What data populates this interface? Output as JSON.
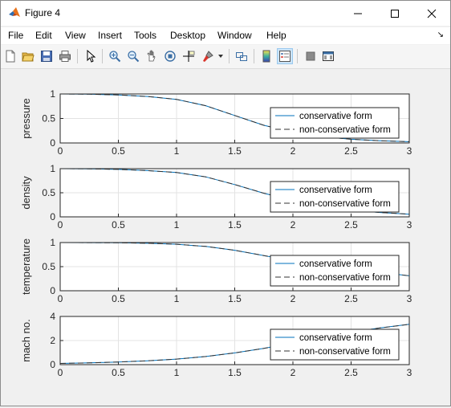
{
  "window": {
    "title": "Figure 4",
    "controls": [
      "minimize",
      "maximize",
      "close"
    ]
  },
  "menu": [
    "File",
    "Edit",
    "View",
    "Insert",
    "Tools",
    "Desktop",
    "Window",
    "Help"
  ],
  "toolbar": {
    "icons": [
      "new-figure-icon",
      "open-file-icon",
      "save-icon",
      "print-icon",
      "select-arrow-icon",
      "zoom-in-icon",
      "zoom-out-icon",
      "pan-icon",
      "rotate-3d-icon",
      "data-cursor-icon",
      "brush-icon",
      "brush-dropdown-icon",
      "link-plot-icon",
      "insert-colorbar-icon",
      "insert-legend-icon",
      "hide-plot-tools-icon",
      "show-plot-tools-icon"
    ]
  },
  "chart_data": [
    {
      "type": "line",
      "ylabel": "pressure",
      "xlim": [
        0,
        3
      ],
      "ylim": [
        0,
        1
      ],
      "xticks": [
        "0",
        "0.5",
        "1",
        "1.5",
        "2",
        "2.5",
        "3"
      ],
      "yticks": [
        "0",
        "0.5",
        "1"
      ],
      "grid": true,
      "legend": {
        "placement": "right",
        "entries": [
          "conservative form",
          "non-conservative form"
        ]
      },
      "x": [
        0,
        0.25,
        0.5,
        0.75,
        1.0,
        1.25,
        1.5,
        1.75,
        2.0,
        2.25,
        2.5,
        2.75,
        3.0
      ],
      "series": [
        {
          "name": "conservative form",
          "color": "#0072bd",
          "style": "solid",
          "values": [
            1.0,
            0.995,
            0.98,
            0.95,
            0.89,
            0.76,
            0.56,
            0.36,
            0.22,
            0.13,
            0.075,
            0.045,
            0.027
          ]
        },
        {
          "name": "non-conservative form",
          "color": "#333333",
          "style": "dashed",
          "values": [
            1.0,
            0.995,
            0.98,
            0.95,
            0.89,
            0.76,
            0.56,
            0.36,
            0.22,
            0.13,
            0.075,
            0.045,
            0.027
          ]
        }
      ]
    },
    {
      "type": "line",
      "ylabel": "density",
      "xlim": [
        0,
        3
      ],
      "ylim": [
        0,
        1
      ],
      "xticks": [
        "0",
        "0.5",
        "1",
        "1.5",
        "2",
        "2.5",
        "3"
      ],
      "yticks": [
        "0",
        "0.5",
        "1"
      ],
      "grid": true,
      "legend": {
        "placement": "right",
        "entries": [
          "conservative form",
          "non-conservative form"
        ]
      },
      "x": [
        0,
        0.25,
        0.5,
        0.75,
        1.0,
        1.25,
        1.5,
        1.75,
        2.0,
        2.25,
        2.5,
        2.75,
        3.0
      ],
      "series": [
        {
          "name": "conservative form",
          "color": "#0072bd",
          "style": "solid",
          "values": [
            1.0,
            0.996,
            0.985,
            0.96,
            0.92,
            0.83,
            0.67,
            0.49,
            0.34,
            0.22,
            0.14,
            0.09,
            0.055
          ]
        },
        {
          "name": "non-conservative form",
          "color": "#333333",
          "style": "dashed",
          "values": [
            1.0,
            0.996,
            0.985,
            0.96,
            0.92,
            0.83,
            0.67,
            0.49,
            0.34,
            0.22,
            0.14,
            0.09,
            0.055
          ]
        }
      ]
    },
    {
      "type": "line",
      "ylabel": "temperature",
      "xlim": [
        0,
        3
      ],
      "ylim": [
        0,
        1
      ],
      "xticks": [
        "0",
        "0.5",
        "1",
        "1.5",
        "2",
        "2.5",
        "3"
      ],
      "yticks": [
        "0",
        "0.5",
        "1"
      ],
      "grid": true,
      "legend": {
        "placement": "right",
        "entries": [
          "conservative form",
          "non-conservative form"
        ]
      },
      "x": [
        0,
        0.25,
        0.5,
        0.75,
        1.0,
        1.25,
        1.5,
        1.75,
        2.0,
        2.25,
        2.5,
        2.75,
        3.0
      ],
      "series": [
        {
          "name": "conservative form",
          "color": "#0072bd",
          "style": "solid",
          "values": [
            1.0,
            0.999,
            0.995,
            0.985,
            0.965,
            0.92,
            0.84,
            0.73,
            0.62,
            0.53,
            0.45,
            0.38,
            0.31
          ]
        },
        {
          "name": "non-conservative form",
          "color": "#333333",
          "style": "dashed",
          "values": [
            1.0,
            0.999,
            0.995,
            0.985,
            0.965,
            0.92,
            0.84,
            0.73,
            0.62,
            0.53,
            0.45,
            0.38,
            0.31
          ]
        }
      ]
    },
    {
      "type": "line",
      "ylabel": "mach no.",
      "xlim": [
        0,
        3
      ],
      "ylim": [
        0,
        4
      ],
      "xticks": [
        "0",
        "0.5",
        "1",
        "1.5",
        "2",
        "2.5",
        "3"
      ],
      "yticks": [
        "0",
        "2",
        "4"
      ],
      "grid": true,
      "legend": {
        "placement": "right",
        "entries": [
          "conservative form",
          "non-conservative form"
        ]
      },
      "x": [
        0,
        0.25,
        0.5,
        0.75,
        1.0,
        1.25,
        1.5,
        1.75,
        2.0,
        2.25,
        2.5,
        2.75,
        3.0
      ],
      "series": [
        {
          "name": "conservative form",
          "color": "#0072bd",
          "style": "solid",
          "values": [
            0.1,
            0.15,
            0.22,
            0.32,
            0.46,
            0.67,
            0.97,
            1.35,
            1.8,
            2.25,
            2.7,
            3.05,
            3.35
          ]
        },
        {
          "name": "non-conservative form",
          "color": "#333333",
          "style": "dashed",
          "values": [
            0.1,
            0.15,
            0.22,
            0.32,
            0.46,
            0.67,
            0.97,
            1.35,
            1.8,
            2.25,
            2.7,
            3.05,
            3.35
          ]
        }
      ]
    }
  ]
}
